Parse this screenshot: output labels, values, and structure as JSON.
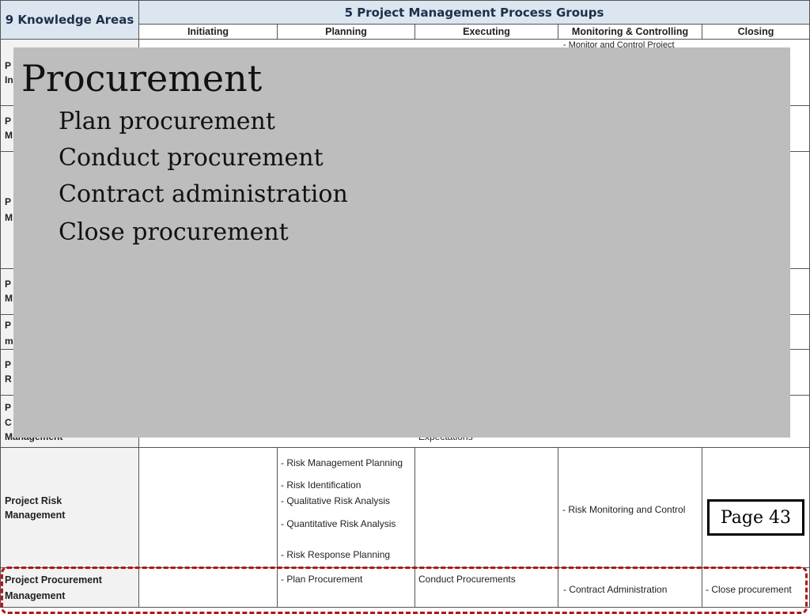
{
  "table": {
    "corner_header": "9 Knowledge Areas",
    "groups_header": "5 Project Management Process Groups",
    "columns": [
      "Initiating",
      "Planning",
      "Executing",
      "Monitoring & Controlling",
      "Closing"
    ],
    "partial": {
      "monitor_top": "- Monitor and Control Project",
      "executing_fragment": "Expectations",
      "row_initials": [
        "P",
        "In",
        "P",
        "M",
        "P",
        "M",
        "P",
        "M",
        "P",
        "m",
        "P",
        "R",
        "P",
        "C",
        "Management"
      ]
    },
    "risk_row": {
      "label_line1": "Project Risk",
      "label_line2": "Management",
      "planning": [
        "- Risk Management Planning",
        "- Risk Identification",
        "- Qualitative Risk Analysis",
        "- Quantitative Risk Analysis",
        "- Risk Response Planning"
      ],
      "monitoring": "- Risk Monitoring and Control"
    },
    "procurement_row": {
      "label_line1": "Project Procurement",
      "label_line2": "Management",
      "planning": "- Plan Procurement",
      "executing": "Conduct Procurements",
      "monitoring": "- Contract Administration",
      "closing": "- Close procurement"
    }
  },
  "overlay": {
    "title": "Procurement",
    "items": [
      "Plan procurement",
      "Conduct procurement",
      "Contract administration",
      "Close procurement"
    ]
  },
  "page_label": "Page 43"
}
